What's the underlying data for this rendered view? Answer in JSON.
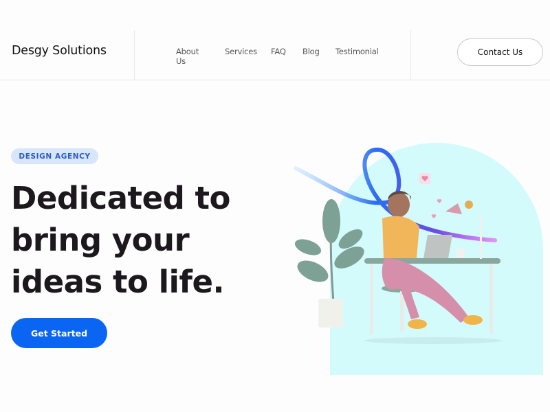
{
  "header": {
    "brand": "Desgy Solutions",
    "nav": [
      {
        "label": "About Us"
      },
      {
        "label": "Services"
      },
      {
        "label": "FAQ"
      },
      {
        "label": "Blog"
      },
      {
        "label": "Testimonial"
      }
    ],
    "contact_label": "Contact Us"
  },
  "hero": {
    "badge": "DESIGN AGENCY",
    "headline_lines": [
      "Dedicated to",
      "bring your",
      "ideas to life."
    ],
    "cta_label": "Get Started",
    "illustration": "woman-at-desk-with-laptop-plant-and-lamp"
  },
  "colors": {
    "accent": "#0a66f2",
    "badge_bg": "#d8e6fb",
    "badge_text": "#2c5cc0",
    "hero_bg": "#d4fbfc",
    "text": "#1c181d"
  }
}
